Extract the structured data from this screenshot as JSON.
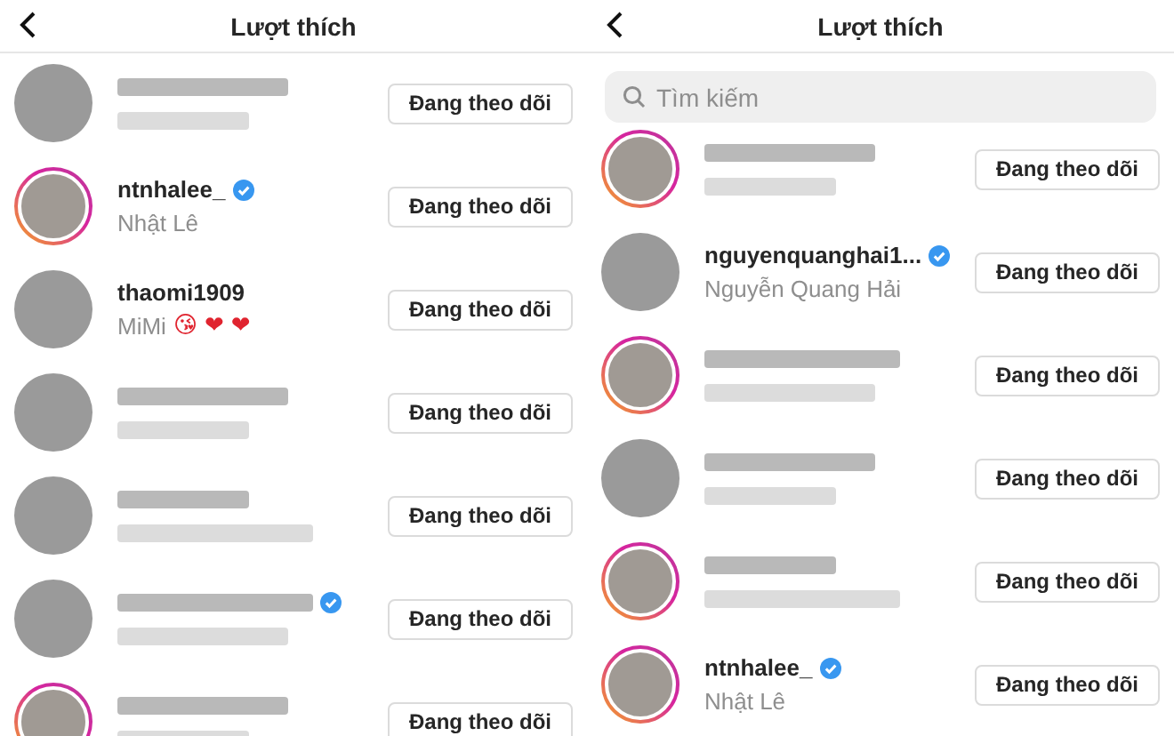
{
  "panels": [
    {
      "header": {
        "title": "Lượt thích"
      },
      "rows": [
        {
          "kind": "blurred",
          "story_ring": false,
          "verified": false,
          "button": "Đang theo dõi"
        },
        {
          "kind": "plain",
          "username": "ntnhalee_",
          "fullname": "Nhật Lê",
          "story_ring": true,
          "verified": true,
          "button": "Đang theo dõi"
        },
        {
          "kind": "plain",
          "username": "thaomi1909",
          "fullname": "MiMi",
          "emoji": [
            "😘",
            "❤",
            "❤"
          ],
          "story_ring": false,
          "verified": false,
          "button": "Đang theo dõi"
        },
        {
          "kind": "blurred",
          "story_ring": false,
          "verified": false,
          "button": "Đang theo dõi"
        },
        {
          "kind": "blurred",
          "story_ring": false,
          "verified": false,
          "button": "Đang theo dõi"
        },
        {
          "kind": "blurred",
          "story_ring": false,
          "verified": true,
          "button": "Đang theo dõi"
        },
        {
          "kind": "blurred",
          "story_ring": true,
          "verified": false,
          "button": "Đang theo dõi"
        }
      ]
    },
    {
      "header": {
        "title": "Lượt thích"
      },
      "search": {
        "placeholder": "Tìm kiếm"
      },
      "rows": [
        {
          "kind": "blurred",
          "story_ring": true,
          "verified": false,
          "button": "Đang theo dõi"
        },
        {
          "kind": "plain",
          "username": "nguyenquanghai1...",
          "fullname": "Nguyễn Quang Hải",
          "story_ring": false,
          "verified": true,
          "button": "Đang theo dõi"
        },
        {
          "kind": "blurred",
          "story_ring": true,
          "verified": false,
          "button": "Đang theo dõi"
        },
        {
          "kind": "blurred",
          "story_ring": false,
          "verified": false,
          "button": "Đang theo dõi"
        },
        {
          "kind": "blurred",
          "story_ring": true,
          "verified": false,
          "button": "Đang theo dõi"
        },
        {
          "kind": "plain",
          "username": "ntnhalee_",
          "fullname": "Nhật Lê",
          "story_ring": true,
          "verified": true,
          "button": "Đang theo dõi"
        }
      ]
    }
  ]
}
